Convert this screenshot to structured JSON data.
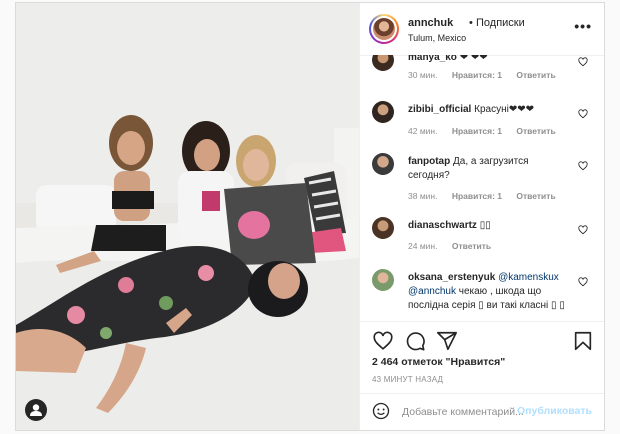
{
  "post": {
    "username": "annchuk",
    "separator": "•",
    "follow_label": "Подписки",
    "location": "Tulum, Mexico",
    "more_label": "•••"
  },
  "comments": [
    {
      "user": "manya_ko",
      "text": "❤ ❤❤",
      "time": "30 мин.",
      "likes": "Нравится: 1",
      "reply": "Ответить"
    },
    {
      "user": "zibibi_official",
      "text": "Красуні❤❤❤",
      "time": "42 мин.",
      "likes": "Нравится: 1",
      "reply": "Ответить"
    },
    {
      "user": "fanpotap",
      "text": "Да, а загрузится сегодня?",
      "time": "38 мин.",
      "likes": "Нравится: 1",
      "reply": "Ответить"
    },
    {
      "user": "dianaschwartz",
      "text": "▯▯",
      "time": "24 мин.",
      "reply": "Ответить"
    },
    {
      "user": "oksana_erstenyuk",
      "mention1": "@kamenskux",
      "mention2": "@annchuk",
      "text": "чекаю , шкода що послідна серія ▯ ви такі класні ▯",
      "tail": "▯"
    }
  ],
  "likes_text": "2 464 отметок \"Нравится\"",
  "time_ago": "43 МИНУТ НАЗАД",
  "comment_input": {
    "placeholder": "Добавьте комментарий..."
  },
  "publish_label": "Опубликовать",
  "colors": {
    "link": "#00376b",
    "publish_disabled": "#b2dffc",
    "meta": "#8e8e8e",
    "border": "#dbdbdb"
  },
  "icons": [
    "heart-icon",
    "comment-icon",
    "share-icon",
    "bookmark-icon",
    "emoji-icon",
    "user-tag-icon",
    "more-icon"
  ]
}
